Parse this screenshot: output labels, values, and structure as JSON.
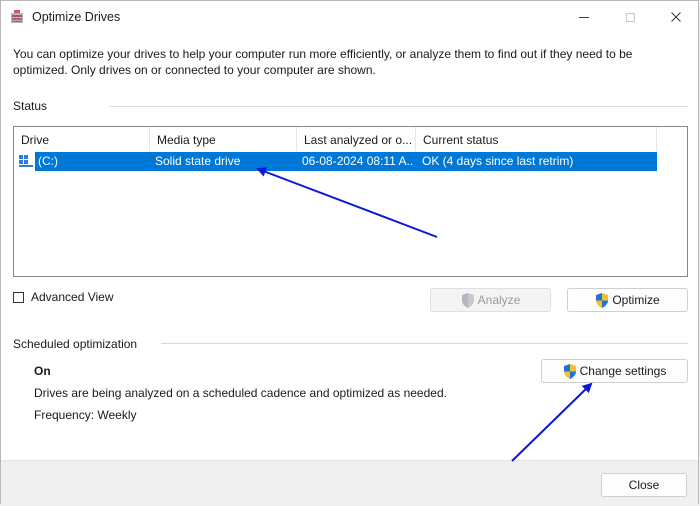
{
  "window": {
    "title": "Optimize Drives"
  },
  "intro_text": "You can optimize your drives to help your computer run more efficiently, or analyze them to find out if they need to be optimized. Only drives on or connected to your computer are shown.",
  "status": {
    "label": "Status",
    "columns": [
      "Drive",
      "Media type",
      "Last analyzed or o...",
      "Current status"
    ],
    "rows": [
      {
        "drive": "(C:)",
        "media_type": "Solid state drive",
        "last_analyzed": "06-08-2024 08:11 A...",
        "current_status": "OK (4 days since last retrim)"
      }
    ]
  },
  "advanced_view_label": "Advanced View",
  "buttons": {
    "analyze": "Analyze",
    "optimize": "Optimize",
    "change_settings": "Change settings",
    "close": "Close"
  },
  "scheduled": {
    "label": "Scheduled optimization",
    "state": "On",
    "description": "Drives are being analyzed on a scheduled cadence and optimized as needed.",
    "frequency": "Frequency: Weekly"
  },
  "colors": {
    "selection": "#0078d7",
    "annotation_arrow": "#0a18d8"
  }
}
